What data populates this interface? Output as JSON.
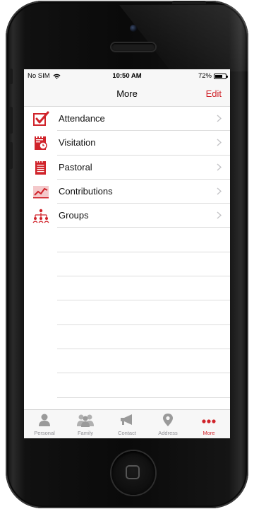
{
  "status_bar": {
    "carrier": "No SIM",
    "time": "10:50 AM",
    "battery": "72%",
    "battery_level": 0.72
  },
  "nav": {
    "title": "More",
    "edit_label": "Edit"
  },
  "menu": [
    {
      "label": "Attendance",
      "icon": "checkbox-icon"
    },
    {
      "label": "Visitation",
      "icon": "calendar-clock-icon"
    },
    {
      "label": "Pastoral",
      "icon": "notepad-icon"
    },
    {
      "label": "Contributions",
      "icon": "line-chart-icon"
    },
    {
      "label": "Groups",
      "icon": "org-chart-icon"
    }
  ],
  "tabs": [
    {
      "label": "Personal",
      "icon": "person-icon"
    },
    {
      "label": "Family",
      "icon": "family-icon"
    },
    {
      "label": "Contact",
      "icon": "megaphone-icon"
    },
    {
      "label": "Address",
      "icon": "map-pin-icon"
    },
    {
      "label": "More",
      "icon": "more-dots-icon",
      "active": true
    }
  ],
  "colors": {
    "accent": "#d0232a",
    "inactive": "#8e8e93"
  }
}
